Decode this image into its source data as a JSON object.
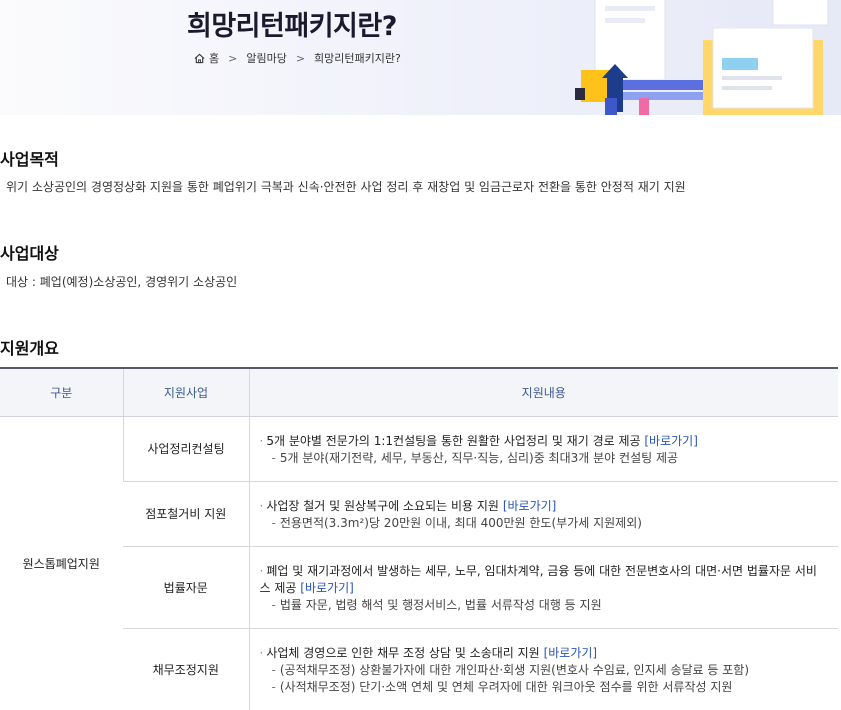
{
  "header": {
    "title": "희망리턴패키지란?",
    "breadcrumb": [
      "홈",
      "알림마당",
      "희망리턴패키지란?"
    ]
  },
  "sections": {
    "purpose": {
      "title": "사업목적",
      "text": "위기 소상공인의 경영정상화 지원을 통한 폐업위기 극복과 신속·안전한 사업 정리 후 재창업 및 임금근로자 전환을 통한 안정적 재기 지원"
    },
    "target": {
      "title": "사업대상",
      "text": "대상 : 폐업(예정)소상공인, 경영위기 소상공인"
    },
    "overview": {
      "title": "지원개요"
    }
  },
  "table": {
    "headers": [
      "구분",
      "지원사업",
      "지원내용"
    ],
    "category": "원스톱폐업지원",
    "rows": [
      {
        "program": "사업정리컨설팅",
        "main": "5개 분야별 전문가의 1:1컨설팅을 통한 원활한 사업정리 및 재기 경로 제공",
        "link": "[바로가기]",
        "subs": [
          "5개 분야(재기전략, 세무, 부동산, 직무·직능, 심리)중 최대3개 분야 컨설팅 제공"
        ]
      },
      {
        "program": "점포철거비 지원",
        "main": "사업장 철거 및 원상복구에 소요되는 비용 지원",
        "link": "[바로가기]",
        "subs": [
          "전용면적(3.3m²)당 20만원 이내, 최대 400만원 한도(부가세 지원제외)"
        ]
      },
      {
        "program": "법률자문",
        "main": "폐업 및 재기과정에서 발생하는 세무, 노무, 임대차계약, 금융 등에 대한 전문변호사의 대면·서면 법률자문 서비스 제공",
        "link": "[바로가기]",
        "subs": [
          "법률 자문, 법령 해석 및 행정서비스, 법률 서류작성 대행 등 지원"
        ]
      },
      {
        "program": "채무조정지원",
        "main": "사업체 경영으로 인한 채무 조정 상담 및 소송대리 지원",
        "link": "[바로가기]",
        "subs": [
          "(공적채무조정) 상환불가자에 대한 개인파산·회생 지원(변호사 수임료, 인지세 송달료 등 포함)",
          "(사적채무조정) 단기·소액 연체 및 연체 우려자에 대한 워크아웃 점수를 위한 서류작성 지원"
        ]
      }
    ]
  },
  "icons": {
    "home": "home-icon",
    "illustration": "documents-chart-illustration"
  }
}
